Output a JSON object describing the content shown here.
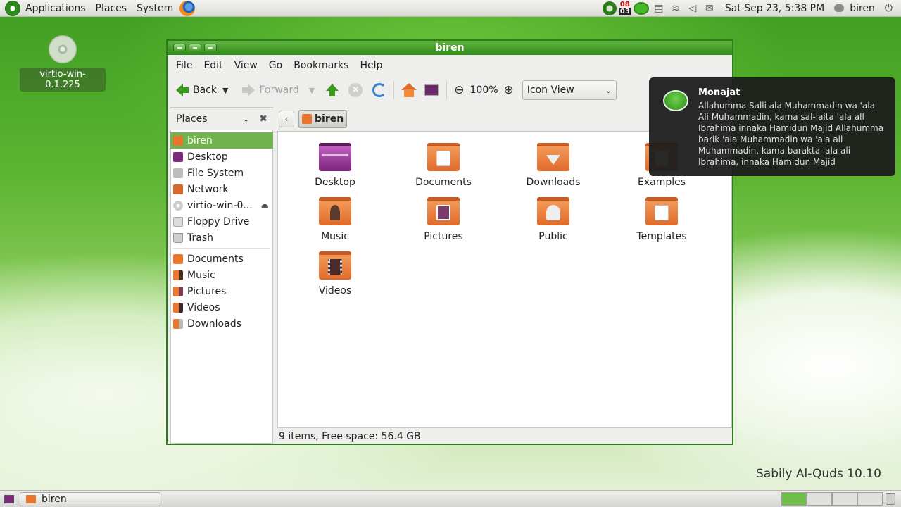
{
  "top_panel": {
    "menus": [
      "Applications",
      "Places",
      "System"
    ],
    "tray_date": {
      "day": "08",
      "num": "03"
    },
    "clock": "Sat Sep 23,  5:38 PM",
    "user": "biren"
  },
  "desktop": {
    "icon_label": "virtio-win-0.1.225",
    "brand": "Sabily Al-Quds 10.10"
  },
  "window": {
    "title": "biren",
    "menubar": [
      "File",
      "Edit",
      "View",
      "Go",
      "Bookmarks",
      "Help"
    ],
    "toolbar": {
      "back": "Back",
      "forward": "Forward",
      "zoom": "100%",
      "view_mode": "Icon View"
    },
    "sidebar": {
      "header": "Places",
      "items": [
        {
          "label": "biren",
          "icon": "home-icon",
          "selected": true
        },
        {
          "label": "Desktop",
          "icon": "desktop-icon"
        },
        {
          "label": "File System",
          "icon": "file-system-icon"
        },
        {
          "label": "Network",
          "icon": "network-icon"
        },
        {
          "label": "virtio-win-0...",
          "icon": "cd-icon"
        },
        {
          "label": "Floppy Drive",
          "icon": "floppy-icon"
        },
        {
          "label": "Trash",
          "icon": "trash-icon"
        }
      ],
      "bookmarks": [
        {
          "label": "Documents",
          "icon": "folder-documents-icon"
        },
        {
          "label": "Music",
          "icon": "folder-music-icon"
        },
        {
          "label": "Pictures",
          "icon": "folder-pictures-icon"
        },
        {
          "label": "Videos",
          "icon": "folder-videos-icon"
        },
        {
          "label": "Downloads",
          "icon": "folder-downloads-icon"
        }
      ]
    },
    "location": {
      "crumb": "biren"
    },
    "files": [
      {
        "label": "Desktop"
      },
      {
        "label": "Documents"
      },
      {
        "label": "Downloads"
      },
      {
        "label": "Examples"
      },
      {
        "label": "Music"
      },
      {
        "label": "Pictures"
      },
      {
        "label": "Public"
      },
      {
        "label": "Templates"
      },
      {
        "label": "Videos"
      }
    ],
    "status": "9 items, Free space: 56.4 GB"
  },
  "notification": {
    "title": "Monajat",
    "body": "Allahumma Salli ala Muhammadin wa 'ala Ali Muhammadin, kama sal-laita 'ala all Ibrahima innaka Hamidun Majid Allahumma barik 'ala Muhammadin wa 'ala all Muhammadin, kama barakta 'ala ali Ibrahima, innaka Hamidun Majid"
  },
  "bottom_panel": {
    "task": "biren"
  },
  "colors": {
    "accent": "#2e8a1a",
    "selection": "#72b34f",
    "folder": "#e06a2a"
  }
}
